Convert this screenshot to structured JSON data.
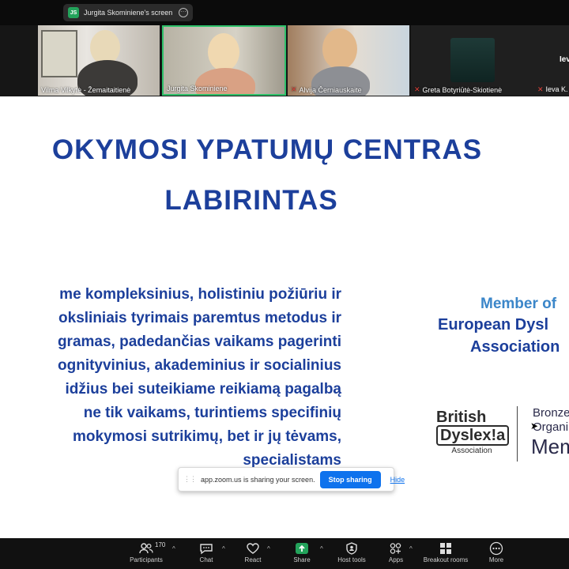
{
  "screen_share": {
    "presenter_initials": "JS",
    "label": "Jurgita Skominiene's screen"
  },
  "participants": [
    {
      "name": "Vilma Vilkytė - Žemaitaitienė",
      "muted": false
    },
    {
      "name": "Jurgita Skominiene",
      "muted": false,
      "active_speaker": true
    },
    {
      "name": "Alvija Černiauskaite",
      "muted": true
    },
    {
      "name": "Greta Botyriūtė-Skiotienė",
      "muted": true
    },
    {
      "name": "Ieva K.",
      "muted": true,
      "tile_initials": "Iev"
    }
  ],
  "slide": {
    "title_line1": "OKYMOSI YPATUMŲ CENTRAS",
    "title_line2": "LABIRINTAS",
    "body_lines": [
      "me kompleksinius, holistiniu požiūriu ir",
      "oksliniais tyrimais paremtus metodus ir",
      "gramas, padedančias vaikams pagerinti",
      "ognityvinius, akademinius ir socialinius",
      "idžius bei suteikiame reikiamą pagalbą",
      "ne tik vaikams, turintiems specifinių",
      "mokymosi sutrikimų, bet ir jų tėvams,",
      "specialistams"
    ],
    "member_of": "Member of",
    "member_org_line1": "European Dysl",
    "member_org_line2": "Association",
    "bda_line1": "British",
    "bda_line2": "Dyslex!a",
    "bda_line3": "Association",
    "bronze_line1": "Bronze",
    "bronze_line2": "Organi",
    "bronze_line3": "Mem"
  },
  "share_banner": {
    "text": "app.zoom.us is sharing your screen.",
    "stop_label": "Stop sharing",
    "hide_label": "Hide"
  },
  "toolbar": {
    "participant_count": "170",
    "items": [
      {
        "label": "Participants",
        "icon": "participants-icon"
      },
      {
        "label": "Chat",
        "icon": "chat-icon"
      },
      {
        "label": "React",
        "icon": "heart-icon"
      },
      {
        "label": "Share",
        "icon": "share-icon"
      },
      {
        "label": "Host tools",
        "icon": "shield-icon"
      },
      {
        "label": "Apps",
        "icon": "apps-icon"
      },
      {
        "label": "Breakout rooms",
        "icon": "grid-icon"
      },
      {
        "label": "More",
        "icon": "more-icon"
      }
    ]
  },
  "colors": {
    "slide_text": "#1c3f9b",
    "member_accent": "#3b86c9",
    "share_green": "#23a35b",
    "stop_blue": "#0e72ed",
    "mic_muted_red": "#e0433b"
  }
}
